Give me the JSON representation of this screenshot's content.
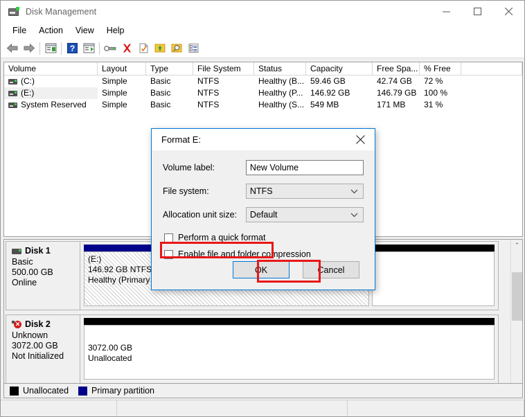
{
  "window": {
    "title": "Disk Management",
    "icon": "disk-management-icon",
    "controls": {
      "minimize": "–",
      "maximize": "☐",
      "close": "✕"
    }
  },
  "menu": {
    "items": [
      "File",
      "Action",
      "View",
      "Help"
    ]
  },
  "toolbar": {
    "buttons": [
      {
        "name": "back-icon"
      },
      {
        "name": "forward-icon"
      },
      {
        "name": "show-hide-console-tree-icon"
      },
      {
        "name": "help-icon"
      },
      {
        "name": "show-hide-action-pane-icon"
      },
      {
        "name": "properties-icon"
      },
      {
        "name": "delete-icon"
      },
      {
        "name": "new-task-icon"
      },
      {
        "name": "rescan-disks-icon"
      },
      {
        "name": "search-icon"
      },
      {
        "name": "list-view-icon"
      }
    ]
  },
  "volume_list": {
    "columns": [
      "Volume",
      "Layout",
      "Type",
      "File System",
      "Status",
      "Capacity",
      "Free Spa...",
      "% Free",
      ""
    ],
    "rows": [
      {
        "volume": "(C:)",
        "layout": "Simple",
        "type": "Basic",
        "file_system": "NTFS",
        "status": "Healthy (B...",
        "capacity": "59.46 GB",
        "free_space": "42.74 GB",
        "percent_free": "72 %",
        "selected": false
      },
      {
        "volume": "(E:)",
        "layout": "Simple",
        "type": "Basic",
        "file_system": "NTFS",
        "status": "Healthy (P...",
        "capacity": "146.92 GB",
        "free_space": "146.79 GB",
        "percent_free": "100 %",
        "selected": true
      },
      {
        "volume": "System Reserved",
        "layout": "Simple",
        "type": "Basic",
        "file_system": "NTFS",
        "status": "Healthy (S...",
        "capacity": "549 MB",
        "free_space": "171 MB",
        "percent_free": "31 %",
        "selected": false
      }
    ]
  },
  "disks": [
    {
      "name": "Disk 1",
      "icon": "disk-online-icon",
      "type": "Basic",
      "size": "500.00 GB",
      "state": "Online",
      "partitions": [
        {
          "kind": "primary",
          "label": "(E:)",
          "line2": "146.92 GB NTFS",
          "line3": "Healthy (Primary Partition)",
          "hatched": true
        },
        {
          "kind": "unalloc",
          "label": "",
          "line2": "",
          "line3": "",
          "hatched": false
        }
      ]
    },
    {
      "name": "Disk 2",
      "icon": "disk-error-icon",
      "type": "Unknown",
      "size": "3072.00 GB",
      "state": "Not Initialized",
      "partitions": [
        {
          "kind": "unalloc",
          "label": "3072.00 GB",
          "line2": "Unallocated",
          "line3": "",
          "hatched": false
        }
      ]
    }
  ],
  "legend": {
    "items": [
      {
        "label": "Unallocated",
        "color": "#000000",
        "key": "unalloc"
      },
      {
        "label": "Primary partition",
        "color": "#00008b",
        "key": "primary"
      }
    ]
  },
  "dialog": {
    "title": "Format E:",
    "close_icon": "close-icon",
    "fields": [
      {
        "label": "Volume label:",
        "value": "New Volume",
        "control": "text"
      },
      {
        "label": "File system:",
        "value": "NTFS",
        "control": "select"
      },
      {
        "label": "Allocation unit size:",
        "value": "Default",
        "control": "select"
      }
    ],
    "checkboxes": [
      {
        "label": "Perform a quick format",
        "checked": false,
        "highlighted": true
      },
      {
        "label": "Enable file and folder compression",
        "checked": false,
        "highlighted": false
      }
    ],
    "buttons": [
      {
        "label": "OK",
        "default": true,
        "highlighted": true
      },
      {
        "label": "Cancel",
        "default": false,
        "highlighted": false
      }
    ],
    "highlight_color": "#e81717"
  },
  "scrollbar": {
    "up_arrow": "⌃",
    "down_arrow": "⌄"
  }
}
